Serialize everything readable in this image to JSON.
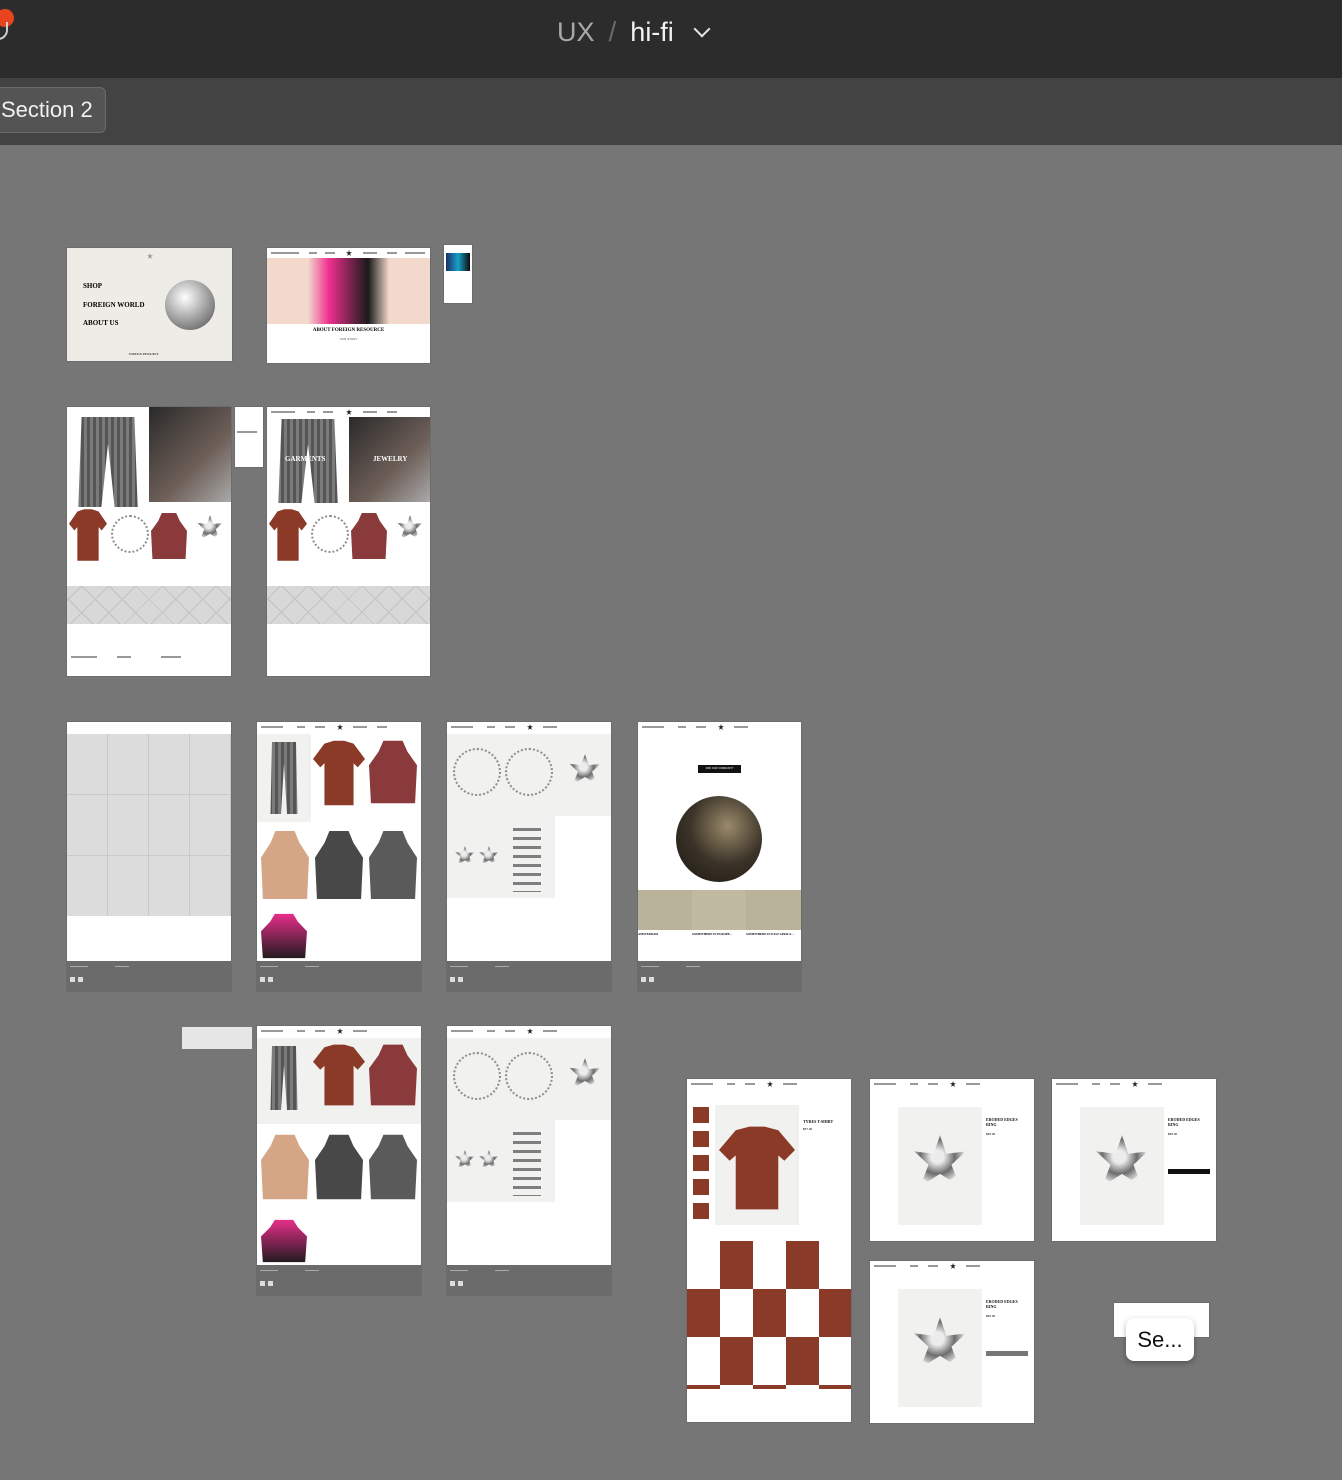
{
  "app": {
    "breadcrumb": {
      "parent": "UX",
      "separator": "/",
      "current": "hi-fi"
    },
    "section_label": "Section 2",
    "tooltip_label": "Se...",
    "colors": {
      "canvas": "#767676",
      "topbar": "#2c2c2c",
      "subbar": "#434343",
      "brand": "#e8451e"
    }
  },
  "frames": {
    "menu": {
      "items": [
        "SHOP",
        "FOREIGN WORLD",
        "ABOUT US"
      ],
      "footer": "FOREIGN RESOURCE"
    },
    "home": {
      "headline": "ABOUT FOREIGN RESOURCE",
      "sub": "OUR STORY"
    },
    "categories": {
      "left": "GARMENTS",
      "right": "JEWELRY"
    },
    "product_tee": {
      "title": "TYRES T-SHIRT",
      "price": "$57.00"
    },
    "product_ring": {
      "title": "ERODED EDGES RING",
      "price": "$95.00"
    },
    "community": {
      "cta": "JOIN OUR COMMUNITY",
      "cities": [
        "AMSTERDAM",
        "SOMEWHERE IN EUROPE...",
        "SOMEWHERE IN EAST AFRICA..."
      ]
    }
  }
}
